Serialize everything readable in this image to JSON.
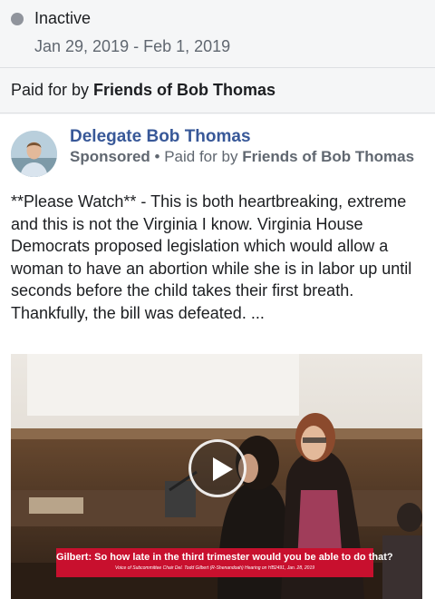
{
  "status": {
    "label": "Inactive",
    "date_range": "Jan 29, 2019 - Feb 1, 2019"
  },
  "paid_for": {
    "prefix": "Paid for by ",
    "name": "Friends of Bob Thomas"
  },
  "ad": {
    "advertiser": "Delegate Bob Thomas",
    "sponsored": "Sponsored",
    "separator": " • ",
    "paid_prefix": "Paid for by ",
    "payer": "Friends of Bob Thomas",
    "body": "**Please Watch** - This is both heartbreaking, extreme and this is not the Virginia I know. Virginia House Democrats proposed legislation which would allow a woman to have an abortion while she is in labor up until seconds before the child takes their first breath. Thankfully, the bill was defeated. ...",
    "video": {
      "caption": "Gilbert: So how late in the third trimester would you be able to do that?",
      "subcaption": "Voice of Subcommittee Chair Del. Todd Gilbert (R-Shenandoah)     Hearing on HB2491, Jan. 28, 2019"
    }
  },
  "colors": {
    "link": "#385898",
    "status_dot": "#90949c",
    "caption_bg": "#c8102e"
  },
  "icons": {
    "status": "status-dot-icon",
    "play": "play-icon"
  }
}
